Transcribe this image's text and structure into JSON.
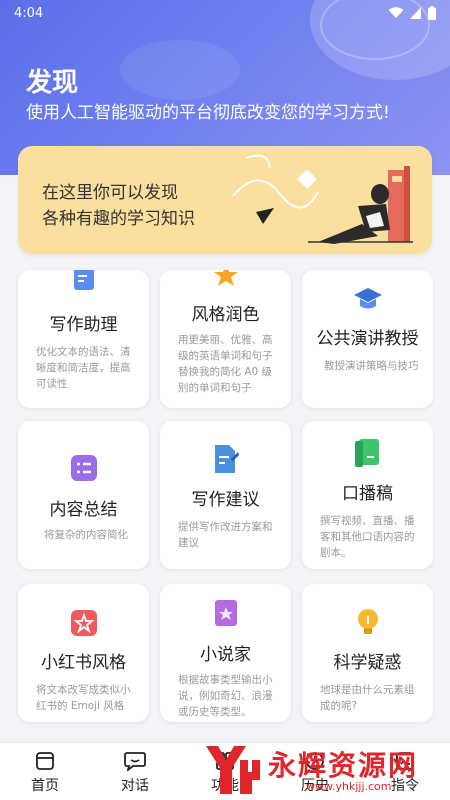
{
  "status": {
    "time": "4:04"
  },
  "header": {
    "title": "发现",
    "subtitle": "使用人工智能驱动的平台彻底改变您的学习方式!"
  },
  "banner": {
    "line1": "在这里你可以发现",
    "line2": "各种有趣的学习知识"
  },
  "cards": [
    {
      "title": "写作助理",
      "desc": "优化文本的语法、清晰度和简洁度，提高可读性",
      "icon": "edit-doc-icon",
      "color": "#5b8def"
    },
    {
      "title": "风格润色",
      "desc": "用更美丽、优雅、高级的英语单词和句子替换我的简化 A0 级别的单词和句子",
      "icon": "star-icon",
      "color": "#f5a524"
    },
    {
      "title": "公共演讲教授",
      "desc": "教授演讲策略与技巧",
      "icon": "graduation-cap-icon",
      "color": "#3b6fd8"
    },
    {
      "title": "内容总结",
      "desc": "将复杂的内容简化",
      "icon": "checklist-icon",
      "color": "#9b6ce8"
    },
    {
      "title": "写作建议",
      "desc": "提供写作改进方案和建议",
      "icon": "doc-pen-icon",
      "color": "#4a90e2"
    },
    {
      "title": "口播稿",
      "desc": "撰写视频、直播、播客和其他口语内容的剧本。",
      "icon": "book-green-icon",
      "color": "#3ec46d"
    },
    {
      "title": "小红书风格",
      "desc": "将文本改写成类似小红书的 Emoji 风格",
      "icon": "badge-star-icon",
      "color": "#ef5b5b"
    },
    {
      "title": "小说家",
      "desc": "根据故事类型输出小说，例如奇幻、浪漫或历史等类型。",
      "icon": "novel-icon",
      "color": "#b46be0"
    },
    {
      "title": "科学疑惑",
      "desc": "地球是由什么元素组成的呢?",
      "icon": "lightbulb-icon",
      "color": "#f5b82e"
    }
  ],
  "tabs": [
    {
      "label": "首页",
      "icon": "home-icon"
    },
    {
      "label": "对话",
      "icon": "chat-icon"
    },
    {
      "label": "功能",
      "icon": "apps-icon"
    },
    {
      "label": "历史",
      "icon": "history-icon"
    },
    {
      "label": "指令",
      "icon": "command-icon"
    }
  ],
  "watermark": {
    "text": "永辉资源网",
    "url": "www.yhkjjj.com"
  }
}
